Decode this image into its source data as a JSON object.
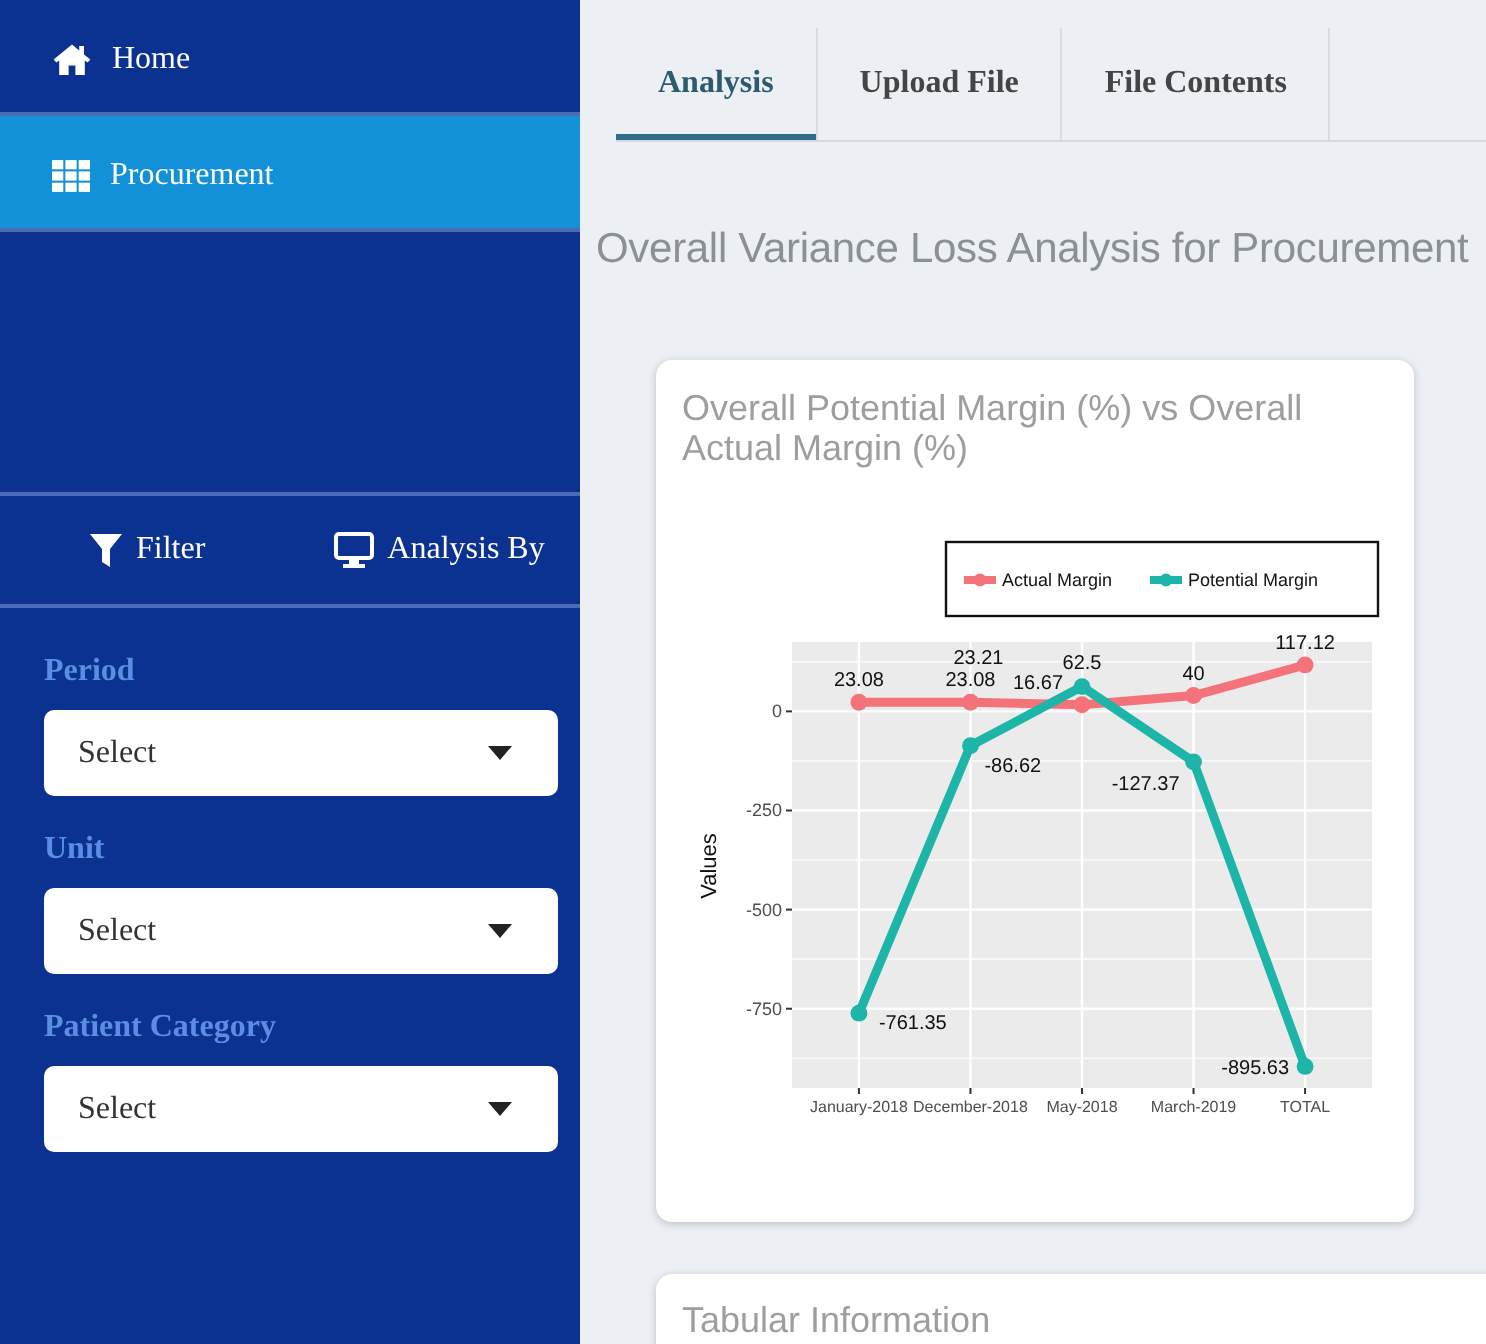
{
  "sidebar": {
    "menu": [
      {
        "label": "Home",
        "selected": false
      },
      {
        "label": "Procurement",
        "selected": true
      }
    ],
    "panel_tabs": [
      {
        "label": "Filter"
      },
      {
        "label": "Analysis By"
      }
    ],
    "filters": [
      {
        "label": "Period",
        "value": "Select"
      },
      {
        "label": "Unit",
        "value": "Select"
      },
      {
        "label": "Patient Category",
        "value": "Select"
      }
    ]
  },
  "tabs": [
    {
      "label": "Analysis",
      "selected": true
    },
    {
      "label": "Upload File",
      "selected": false
    },
    {
      "label": "File Contents",
      "selected": false
    }
  ],
  "page_title": "Overall Variance Loss Analysis for Procurement",
  "chart_card": {
    "title": "Overall Potential Margin (%) vs Overall Actual Margin (%)",
    "chart_data": {
      "type": "line",
      "ylabel": "Values",
      "categories": [
        "January-2018",
        "December-2018",
        "May-2018",
        "March-2019",
        "TOTAL"
      ],
      "series": [
        {
          "name": "Actual Margin",
          "color": "#f4727a",
          "marker": "circle",
          "values": [
            23.08,
            23.08,
            16.67,
            40,
            117.12
          ]
        },
        {
          "name": "Potential Margin",
          "color": "#1eb5a9",
          "marker": "circle",
          "values": [
            -761.35,
            -86.62,
            62.5,
            -127.37,
            -895.63
          ]
        }
      ],
      "ylim": [
        -950,
        175
      ],
      "yticks": [
        -750,
        -500,
        -250,
        0
      ],
      "grid": true,
      "legend": true,
      "data_labels": true,
      "annotations": [
        {
          "x": "December-2018",
          "y": 23.21,
          "text": "23.21"
        }
      ]
    }
  },
  "table_card": {
    "title": "Tabular Information"
  }
}
